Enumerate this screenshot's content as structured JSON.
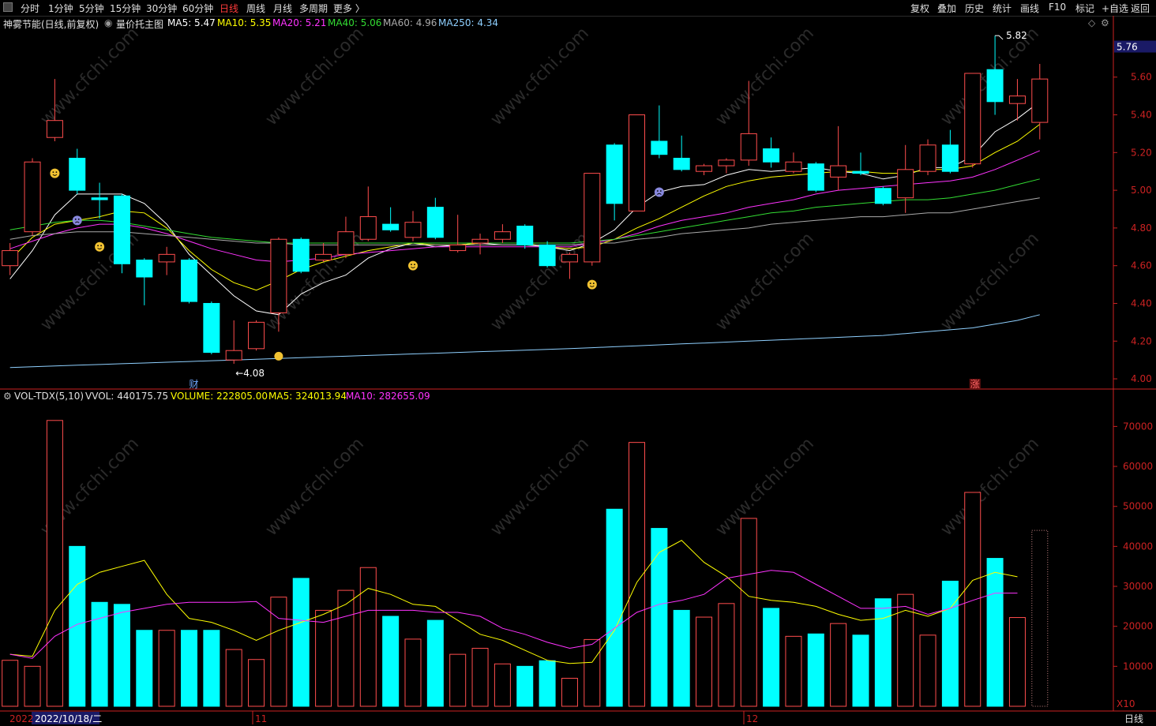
{
  "toolbar": {
    "timeframes": [
      "分时",
      "1分钟",
      "5分钟",
      "15分钟",
      "30分钟",
      "60分钟",
      "日线",
      "周线",
      "月线",
      "多周期",
      "更多 〉"
    ],
    "active_timeframe": "日线",
    "right_buttons": [
      "复权",
      "叠加",
      "历史",
      "统计",
      "画线",
      "F10",
      "标记",
      "+自选",
      "返回"
    ]
  },
  "price_header": {
    "stock": "神雾节能(日线,前复权)",
    "indicator": "量价托主图",
    "ma": [
      {
        "label": "MA5: 5.47",
        "color": "#ffffff"
      },
      {
        "label": "MA10: 5.35",
        "color": "#ffff00"
      },
      {
        "label": "MA20: 5.21",
        "color": "#ff33ff"
      },
      {
        "label": "MA40: 5.06",
        "color": "#33dd33"
      },
      {
        "label": "MA60: 4.96",
        "color": "#aaaaaa"
      },
      {
        "label": "MA250: 4.34",
        "color": "#8fd0ff"
      }
    ]
  },
  "vol_header": {
    "name": "VOL-TDX(5,10)",
    "vvol": "VVOL: 440175.75",
    "volume": "VOLUME: 222805.00",
    "ma5": "MA5: 324013.94",
    "ma10": "MA10: 282655.09"
  },
  "annotations": {
    "high": "5.82",
    "low": "←4.08",
    "current_price": "5.76",
    "cai": "财",
    "zhang": "涨",
    "x10": "X10"
  },
  "bottom": {
    "year": "2022",
    "date": "2022/10/18/二",
    "month_nov": "11",
    "month_dec": "12",
    "period": "日线"
  },
  "colors": {
    "up": "#ff4d4d",
    "down": "#00ffff",
    "ma5": "#ffffff",
    "ma10": "#ffff00",
    "ma20": "#ff33ff",
    "ma40": "#33dd33",
    "ma60": "#aaaaaa",
    "ma250": "#8fd0ff",
    "vol_ma5": "#ffff00",
    "vol_ma10": "#ff33ff",
    "axis": "#cc2222"
  },
  "chart_data": [
    {
      "type": "candlestick",
      "title": "神雾节能(日线,前复权)",
      "ylim": [
        3.95,
        5.85
      ],
      "yticks": [
        4.0,
        4.2,
        4.4,
        4.6,
        4.8,
        5.0,
        5.2,
        5.4,
        5.6
      ],
      "candles": [
        {
          "o": 4.6,
          "c": 4.68,
          "h": 4.72,
          "l": 4.55
        },
        {
          "o": 4.78,
          "c": 5.15,
          "h": 5.17,
          "l": 4.76
        },
        {
          "o": 5.28,
          "c": 5.37,
          "h": 5.59,
          "l": 5.26
        },
        {
          "o": 5.17,
          "c": 5.0,
          "h": 5.22,
          "l": 4.98
        },
        {
          "o": 4.96,
          "c": 4.95,
          "h": 5.04,
          "l": 4.85
        },
        {
          "o": 4.97,
          "c": 4.61,
          "h": 4.98,
          "l": 4.56
        },
        {
          "o": 4.63,
          "c": 4.54,
          "h": 4.64,
          "l": 4.39
        },
        {
          "o": 4.62,
          "c": 4.66,
          "h": 4.7,
          "l": 4.55
        },
        {
          "o": 4.63,
          "c": 4.41,
          "h": 4.64,
          "l": 4.4
        },
        {
          "o": 4.4,
          "c": 4.14,
          "h": 4.41,
          "l": 4.13
        },
        {
          "o": 4.1,
          "c": 4.15,
          "h": 4.31,
          "l": 4.08
        },
        {
          "o": 4.16,
          "c": 4.3,
          "h": 4.31,
          "l": 4.15
        },
        {
          "o": 4.35,
          "c": 4.74,
          "h": 4.75,
          "l": 4.25
        },
        {
          "o": 4.74,
          "c": 4.57,
          "h": 4.75,
          "l": 4.56
        },
        {
          "o": 4.63,
          "c": 4.66,
          "h": 4.72,
          "l": 4.62
        },
        {
          "o": 4.66,
          "c": 4.78,
          "h": 4.86,
          "l": 4.64
        },
        {
          "o": 4.74,
          "c": 4.86,
          "h": 5.02,
          "l": 4.73
        },
        {
          "o": 4.82,
          "c": 4.79,
          "h": 4.91,
          "l": 4.78
        },
        {
          "o": 4.75,
          "c": 4.83,
          "h": 4.89,
          "l": 4.73
        },
        {
          "o": 4.91,
          "c": 4.75,
          "h": 4.96,
          "l": 4.74
        },
        {
          "o": 4.68,
          "c": 4.71,
          "h": 4.87,
          "l": 4.67
        },
        {
          "o": 4.72,
          "c": 4.74,
          "h": 4.77,
          "l": 4.66
        },
        {
          "o": 4.74,
          "c": 4.78,
          "h": 4.82,
          "l": 4.72
        },
        {
          "o": 4.81,
          "c": 4.71,
          "h": 4.82,
          "l": 4.69
        },
        {
          "o": 4.71,
          "c": 4.6,
          "h": 4.73,
          "l": 4.59
        },
        {
          "o": 4.62,
          "c": 4.66,
          "h": 4.67,
          "l": 4.53
        },
        {
          "o": 4.62,
          "c": 5.09,
          "h": 5.09,
          "l": 4.6
        },
        {
          "o": 5.24,
          "c": 4.93,
          "h": 5.25,
          "l": 4.84
        },
        {
          "o": 4.89,
          "c": 5.4,
          "h": 5.4,
          "l": 4.89
        },
        {
          "o": 5.26,
          "c": 5.19,
          "h": 5.45,
          "l": 5.17
        },
        {
          "o": 5.17,
          "c": 5.11,
          "h": 5.29,
          "l": 5.1
        },
        {
          "o": 5.1,
          "c": 5.13,
          "h": 5.14,
          "l": 5.08
        },
        {
          "o": 5.13,
          "c": 5.16,
          "h": 5.17,
          "l": 5.09
        },
        {
          "o": 5.16,
          "c": 5.3,
          "h": 5.58,
          "l": 5.13
        },
        {
          "o": 5.22,
          "c": 5.15,
          "h": 5.28,
          "l": 5.12
        },
        {
          "o": 5.1,
          "c": 5.15,
          "h": 5.2,
          "l": 5.09
        },
        {
          "o": 5.14,
          "c": 5.0,
          "h": 5.15,
          "l": 4.99
        },
        {
          "o": 5.07,
          "c": 5.13,
          "h": 5.34,
          "l": 5.0
        },
        {
          "o": 5.1,
          "c": 5.09,
          "h": 5.2,
          "l": 5.08
        },
        {
          "o": 5.01,
          "c": 4.93,
          "h": 5.02,
          "l": 4.92
        },
        {
          "o": 4.96,
          "c": 5.11,
          "h": 5.24,
          "l": 4.88
        },
        {
          "o": 5.1,
          "c": 5.24,
          "h": 5.27,
          "l": 5.08
        },
        {
          "o": 5.24,
          "c": 5.1,
          "h": 5.32,
          "l": 5.09
        },
        {
          "o": 5.14,
          "c": 5.62,
          "h": 5.62,
          "l": 5.12
        },
        {
          "o": 5.64,
          "c": 5.47,
          "h": 5.82,
          "l": 5.4
        },
        {
          "o": 5.46,
          "c": 5.5,
          "h": 5.59,
          "l": 5.37
        },
        {
          "o": 5.36,
          "c": 5.59,
          "h": 5.67,
          "l": 5.27
        }
      ],
      "ma_series": [
        {
          "name": "MA5",
          "values": [
            4.53,
            4.68,
            4.87,
            4.98,
            4.98,
            4.98,
            4.93,
            4.82,
            4.66,
            4.55,
            4.44,
            4.36,
            4.34,
            4.45,
            4.51,
            4.55,
            4.64,
            4.69,
            4.72,
            4.7,
            4.71,
            4.72,
            4.71,
            4.71,
            4.7,
            4.68,
            4.72,
            4.79,
            4.91,
            4.99,
            5.02,
            5.03,
            5.08,
            5.11,
            5.1,
            5.11,
            5.12,
            5.1,
            5.09,
            5.06,
            5.08,
            5.12,
            5.12,
            5.18,
            5.31,
            5.38,
            5.47
          ]
        },
        {
          "name": "MA10",
          "values": [
            4.63,
            4.75,
            4.82,
            4.84,
            4.86,
            4.89,
            4.88,
            4.8,
            4.68,
            4.58,
            4.51,
            4.47,
            4.52,
            4.58,
            4.62,
            4.65,
            4.68,
            4.7,
            4.72,
            4.71,
            4.71,
            4.72,
            4.72,
            4.72,
            4.7,
            4.69,
            4.7,
            4.74,
            4.8,
            4.85,
            4.91,
            4.97,
            5.02,
            5.05,
            5.07,
            5.08,
            5.09,
            5.1,
            5.1,
            5.09,
            5.09,
            5.11,
            5.11,
            5.13,
            5.2,
            5.26,
            5.35
          ]
        },
        {
          "name": "MA20",
          "values": [
            4.69,
            4.73,
            4.77,
            4.8,
            4.82,
            4.82,
            4.8,
            4.77,
            4.73,
            4.69,
            4.66,
            4.63,
            4.62,
            4.63,
            4.64,
            4.66,
            4.67,
            4.68,
            4.69,
            4.7,
            4.7,
            4.7,
            4.7,
            4.7,
            4.7,
            4.7,
            4.72,
            4.74,
            4.77,
            4.81,
            4.84,
            4.86,
            4.88,
            4.91,
            4.93,
            4.95,
            4.98,
            5.0,
            5.01,
            5.02,
            5.03,
            5.04,
            5.05,
            5.07,
            5.11,
            5.16,
            5.21
          ]
        },
        {
          "name": "MA40",
          "values": [
            4.79,
            4.81,
            4.83,
            4.84,
            4.84,
            4.83,
            4.81,
            4.79,
            4.77,
            4.75,
            4.74,
            4.73,
            4.72,
            4.72,
            4.72,
            4.72,
            4.72,
            4.72,
            4.72,
            4.72,
            4.72,
            4.72,
            4.72,
            4.72,
            4.72,
            4.72,
            4.73,
            4.74,
            4.76,
            4.78,
            4.8,
            4.82,
            4.84,
            4.86,
            4.88,
            4.89,
            4.91,
            4.92,
            4.93,
            4.94,
            4.95,
            4.95,
            4.96,
            4.98,
            5.0,
            5.03,
            5.06
          ]
        },
        {
          "name": "MA60",
          "values": [
            4.74,
            4.76,
            4.77,
            4.78,
            4.78,
            4.78,
            4.77,
            4.76,
            4.75,
            4.74,
            4.73,
            4.72,
            4.72,
            4.71,
            4.71,
            4.71,
            4.71,
            4.71,
            4.71,
            4.71,
            4.71,
            4.71,
            4.71,
            4.71,
            4.71,
            4.71,
            4.72,
            4.72,
            4.74,
            4.75,
            4.77,
            4.78,
            4.79,
            4.8,
            4.82,
            4.83,
            4.84,
            4.85,
            4.86,
            4.86,
            4.87,
            4.88,
            4.88,
            4.9,
            4.92,
            4.94,
            4.96
          ]
        },
        {
          "name": "MA250",
          "values": [
            4.06,
            4.064,
            4.068,
            4.072,
            4.076,
            4.08,
            4.084,
            4.088,
            4.092,
            4.096,
            4.1,
            4.104,
            4.108,
            4.112,
            4.116,
            4.12,
            4.124,
            4.128,
            4.132,
            4.136,
            4.14,
            4.144,
            4.148,
            4.152,
            4.156,
            4.16,
            4.165,
            4.17,
            4.175,
            4.18,
            4.185,
            4.19,
            4.195,
            4.2,
            4.205,
            4.21,
            4.215,
            4.22,
            4.225,
            4.23,
            4.24,
            4.25,
            4.26,
            4.27,
            4.29,
            4.31,
            4.34
          ]
        }
      ]
    },
    {
      "type": "bar",
      "title": "VOL-TDX(5,10)",
      "ylim": [
        0,
        76000
      ],
      "yticks": [
        10000,
        20000,
        30000,
        40000,
        50000,
        60000,
        70000
      ],
      "volumes": [
        11500,
        10000,
        71500,
        40000,
        26000,
        25500,
        19000,
        19000,
        19000,
        19000,
        14200,
        11700,
        27300,
        32000,
        24000,
        29000,
        34700,
        22500,
        16800,
        21500,
        13000,
        14500,
        10600,
        10000,
        11400,
        7000,
        16700,
        49300,
        66000,
        44500,
        24000,
        22300,
        25700,
        47000,
        24500,
        17500,
        18100,
        20700,
        17800,
        26900,
        28000,
        17800,
        31300,
        53500,
        37000,
        22200
      ],
      "vol_ma5": [
        13000,
        12500,
        24000,
        30500,
        33500,
        35000,
        36500,
        28000,
        22000,
        21000,
        19000,
        16500,
        19000,
        21000,
        23000,
        25500,
        29500,
        28000,
        25500,
        25000,
        21500,
        18000,
        16500,
        14000,
        11500,
        10700,
        11000,
        19000,
        31000,
        38500,
        41500,
        36000,
        32500,
        27500,
        26500,
        26000,
        25000,
        23000,
        21500,
        22000,
        24000,
        22500,
        24500,
        31500,
        33500,
        32400
      ],
      "vol_ma10": [
        13000,
        12000,
        17500,
        20500,
        22000,
        23500,
        24500,
        25500,
        26000,
        26000,
        26000,
        26200,
        22000,
        21500,
        21000,
        22500,
        24000,
        24000,
        24000,
        23500,
        23500,
        22500,
        19500,
        18000,
        16000,
        14500,
        15500,
        19500,
        23500,
        25500,
        26500,
        28000,
        32000,
        33000,
        34000,
        33500,
        30500,
        27500,
        24500,
        24500,
        25000,
        23000,
        24500,
        26500,
        28300,
        28300
      ]
    }
  ]
}
